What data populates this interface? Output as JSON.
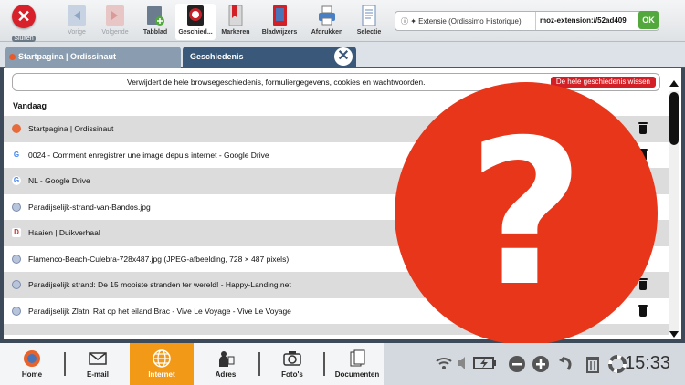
{
  "toolbar": {
    "close_label": "Sluiten",
    "items": [
      {
        "label": "Vorige",
        "icon": "back-arrow-icon",
        "enabled": false
      },
      {
        "label": "Volgende",
        "icon": "forward-arrow-icon",
        "enabled": false
      },
      {
        "label": "Tabblad",
        "icon": "new-tab-icon",
        "enabled": true
      },
      {
        "label": "Geschied...",
        "icon": "history-icon",
        "enabled": true,
        "active": true
      },
      {
        "label": "Markeren",
        "icon": "bookmark-icon",
        "enabled": true
      },
      {
        "label": "Bladwijzers",
        "icon": "bookmarks-book-icon",
        "enabled": true
      },
      {
        "label": "Afdrukken",
        "icon": "printer-icon",
        "enabled": true
      },
      {
        "label": "Selectie",
        "icon": "selection-doc-icon",
        "enabled": true
      }
    ],
    "url_identity": "Extensie (Ordissimo Historique)",
    "url_value": "moz-extension://52ad409",
    "ok_label": "OK"
  },
  "tabs": [
    {
      "label": "Startpagina | Ordissinaut",
      "active": false
    },
    {
      "label": "Geschiedenis",
      "active": true
    }
  ],
  "history": {
    "clear_text": "Verwijdert de hele browsegeschiedenis, formuliergegevens, cookies en wachtwoorden.",
    "clear_button": "De hele geschiedenis wissen",
    "section": "Vandaag",
    "rows": [
      {
        "title": "Startpagina | Ordissinaut",
        "favicon": "ordissimo"
      },
      {
        "title": "0024 - Comment enregistrer une image depuis internet - Google Drive",
        "favicon": "google"
      },
      {
        "title": "NL - Google Drive",
        "favicon": "google"
      },
      {
        "title": "Paradijselijk-strand-van-Bandos.jpg",
        "favicon": "globe"
      },
      {
        "title": "Haaien | Duikverhaal",
        "favicon": "d"
      },
      {
        "title": "Flamenco-Beach-Culebra-728x487.jpg (JPEG-afbeelding, 728 × 487 pixels)",
        "favicon": "globe"
      },
      {
        "title": "Paradijselijk strand: De 15 mooiste stranden ter wereld! - Happy-Landing.net",
        "favicon": "globe"
      },
      {
        "title": "Paradijselijk Zlatni Rat op het eiland Brac - Vive Le Voyage - Vive Le Voyage",
        "favicon": "globe"
      }
    ]
  },
  "overlay": {
    "symbol": "?",
    "color": "#e8361a"
  },
  "taskbar": {
    "items": [
      {
        "label": "Home",
        "icon": "home-icon"
      },
      {
        "label": "E-mail",
        "icon": "mail-icon"
      },
      {
        "label": "Internet",
        "icon": "globe-icon",
        "active": true
      },
      {
        "label": "Adres",
        "icon": "contacts-icon"
      },
      {
        "label": "Foto's",
        "icon": "camera-icon"
      },
      {
        "label": "Documenten",
        "icon": "documents-icon"
      }
    ],
    "clock": "15:33"
  },
  "colors": {
    "accent": "#f29a18",
    "tab_active": "#39587a",
    "danger": "#d31f26",
    "ok": "#52a83c"
  }
}
